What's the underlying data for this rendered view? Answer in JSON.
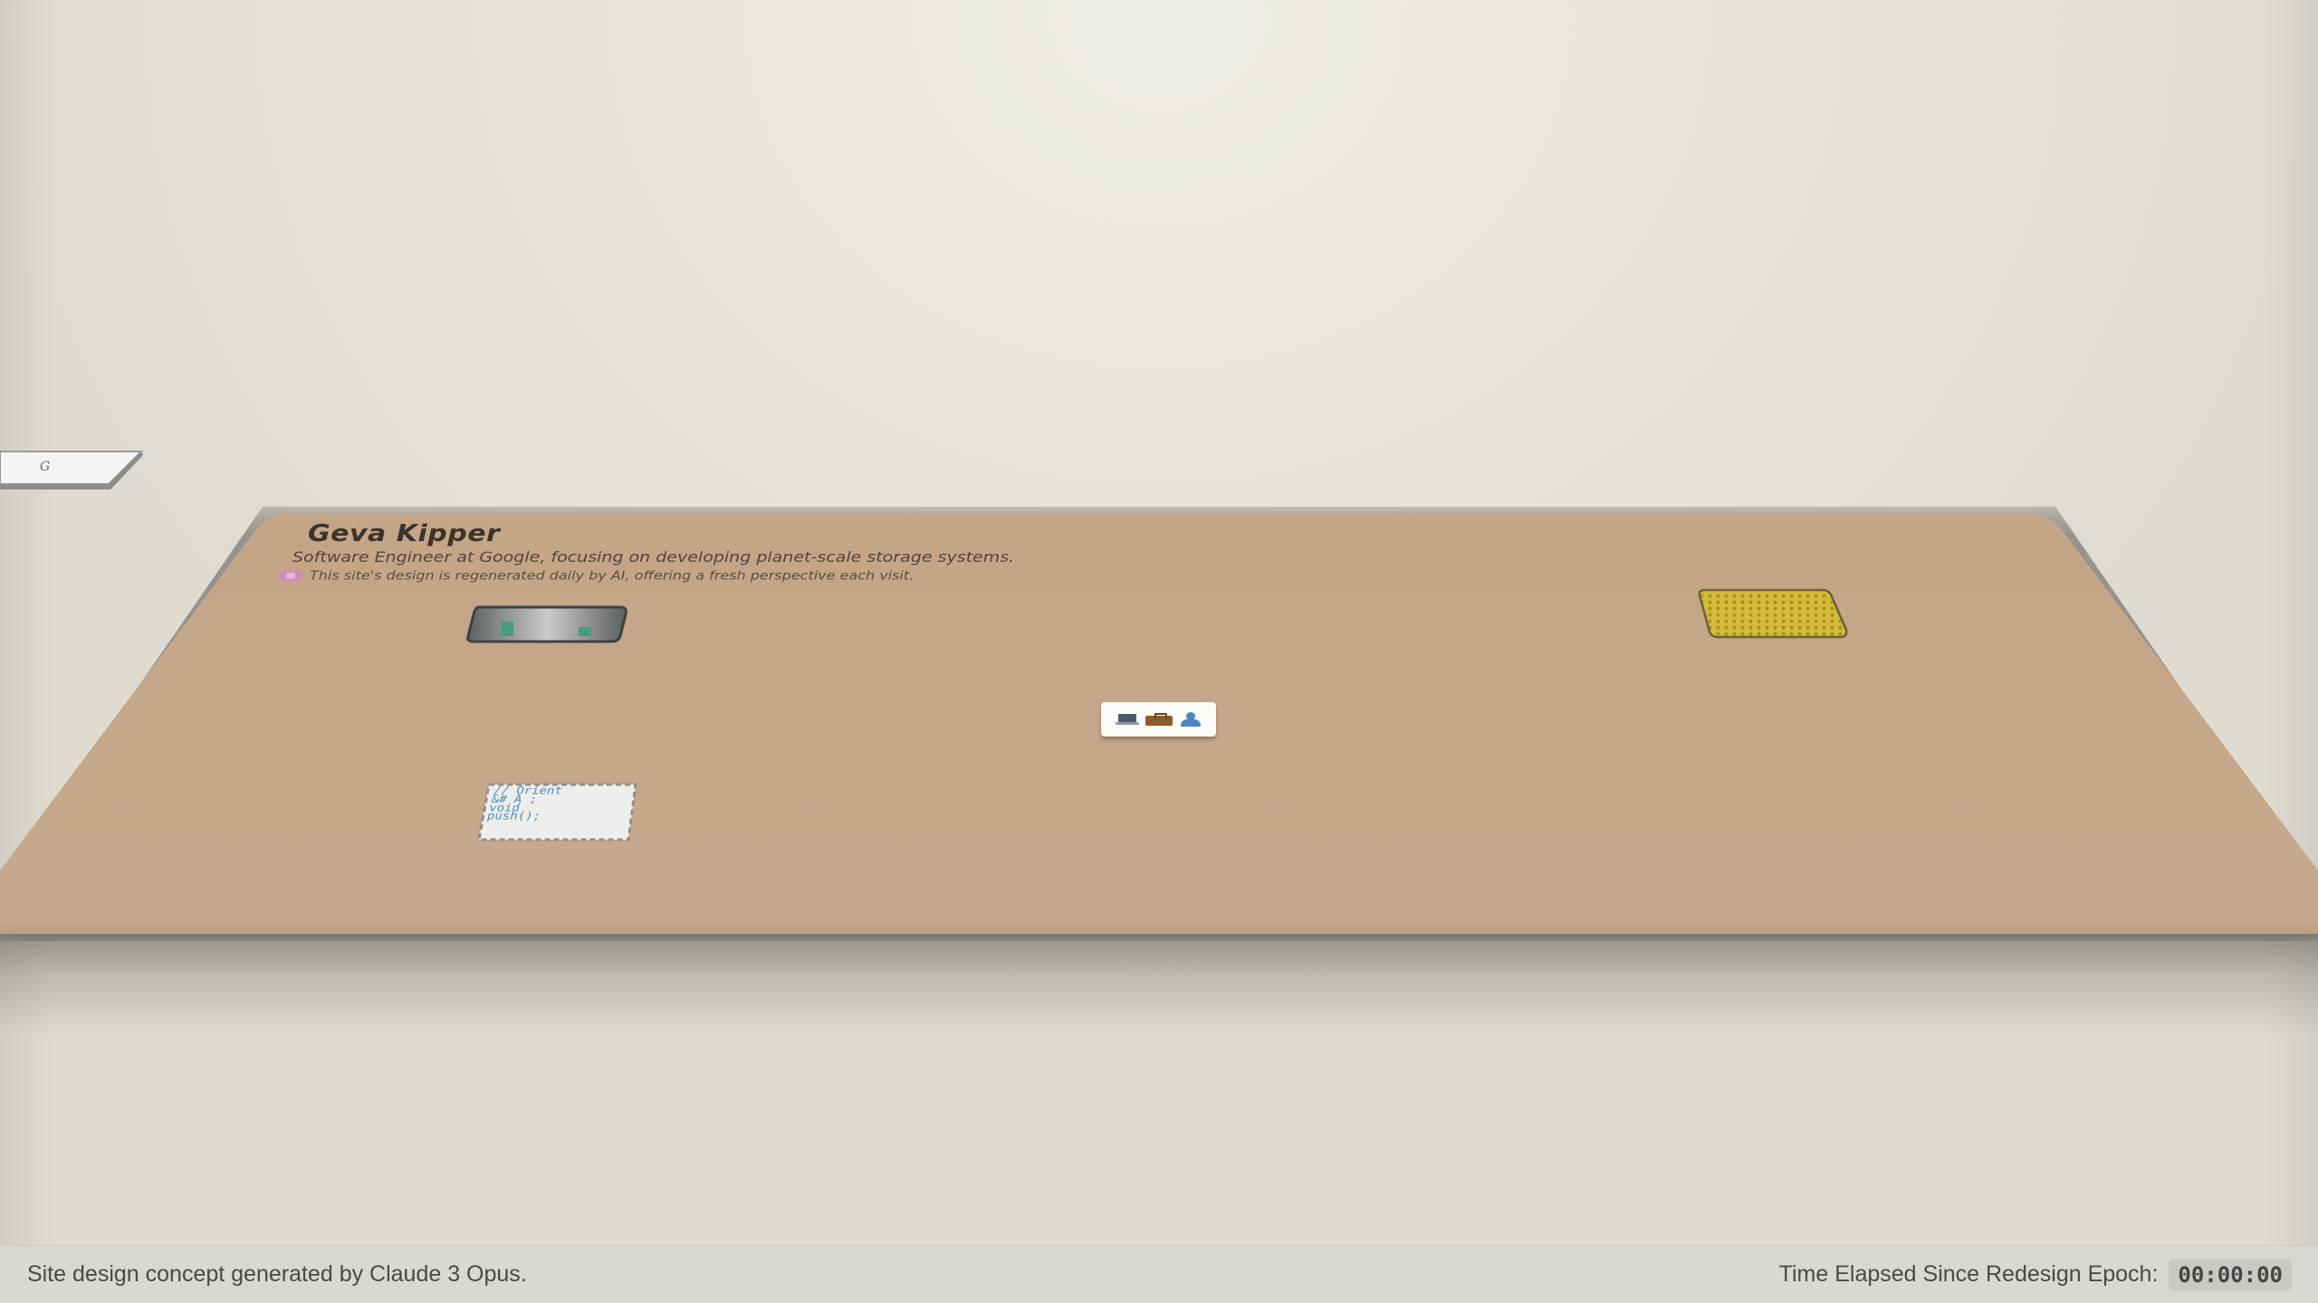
{
  "profile": {
    "name": "Geva Kipper",
    "title": "Software Engineer at Google, focusing on developing planet-scale storage systems.",
    "note": "This site's design is regenerated daily by AI, offering a fresh perspective each visit."
  },
  "side_note": {
    "label": "G"
  },
  "desk_objects": {
    "code_snippet": [
      "// Orient",
      "&# A ;",
      "void",
      "push();"
    ],
    "tools_icons": [
      "laptop-icon",
      "briefcase-icon",
      "person-icon"
    ]
  },
  "footer": {
    "credit": "Site design concept generated by Claude 3 Opus.",
    "timer_label": "Time Elapsed Since Redesign Epoch:",
    "timer_value": "00:00:00"
  },
  "colors": {
    "desk": "#c4a78a",
    "background": "#e8e5dd",
    "footer": "#dad8d3",
    "code_text": "#4f8fb5",
    "pattern_yellow": "#d4bb38"
  }
}
